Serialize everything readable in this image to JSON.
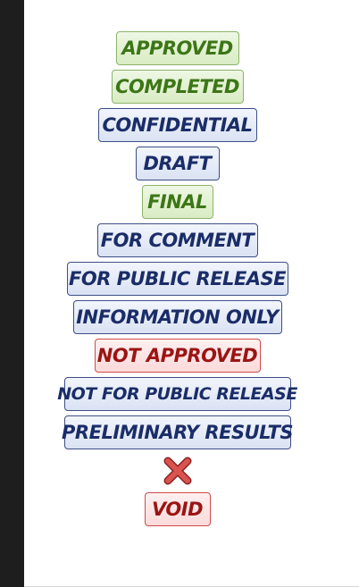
{
  "stamps": [
    {
      "label": "APPROVED",
      "color": "green"
    },
    {
      "label": "COMPLETED",
      "color": "green"
    },
    {
      "label": "CONFIDENTIAL",
      "color": "blue"
    },
    {
      "label": "DRAFT",
      "color": "blue"
    },
    {
      "label": "FINAL",
      "color": "green"
    },
    {
      "label": "FOR COMMENT",
      "color": "blue"
    },
    {
      "label": "FOR PUBLIC RELEASE",
      "color": "blue"
    },
    {
      "label": "INFORMATION ONLY",
      "color": "blue"
    },
    {
      "label": "NOT APPROVED",
      "color": "red"
    },
    {
      "label": "NOT FOR PUBLIC RELEASE",
      "color": "blue"
    },
    {
      "label": "PRELIMINARY RESULTS",
      "color": "blue"
    },
    {
      "label": "VOID",
      "color": "red"
    }
  ],
  "icons": {
    "x_icon": "x-mark-icon"
  },
  "colors": {
    "green_text": "#3c7616",
    "blue_text": "#1a2d68",
    "red_text": "#9b1414",
    "sidebar": "#1e1e1e"
  }
}
